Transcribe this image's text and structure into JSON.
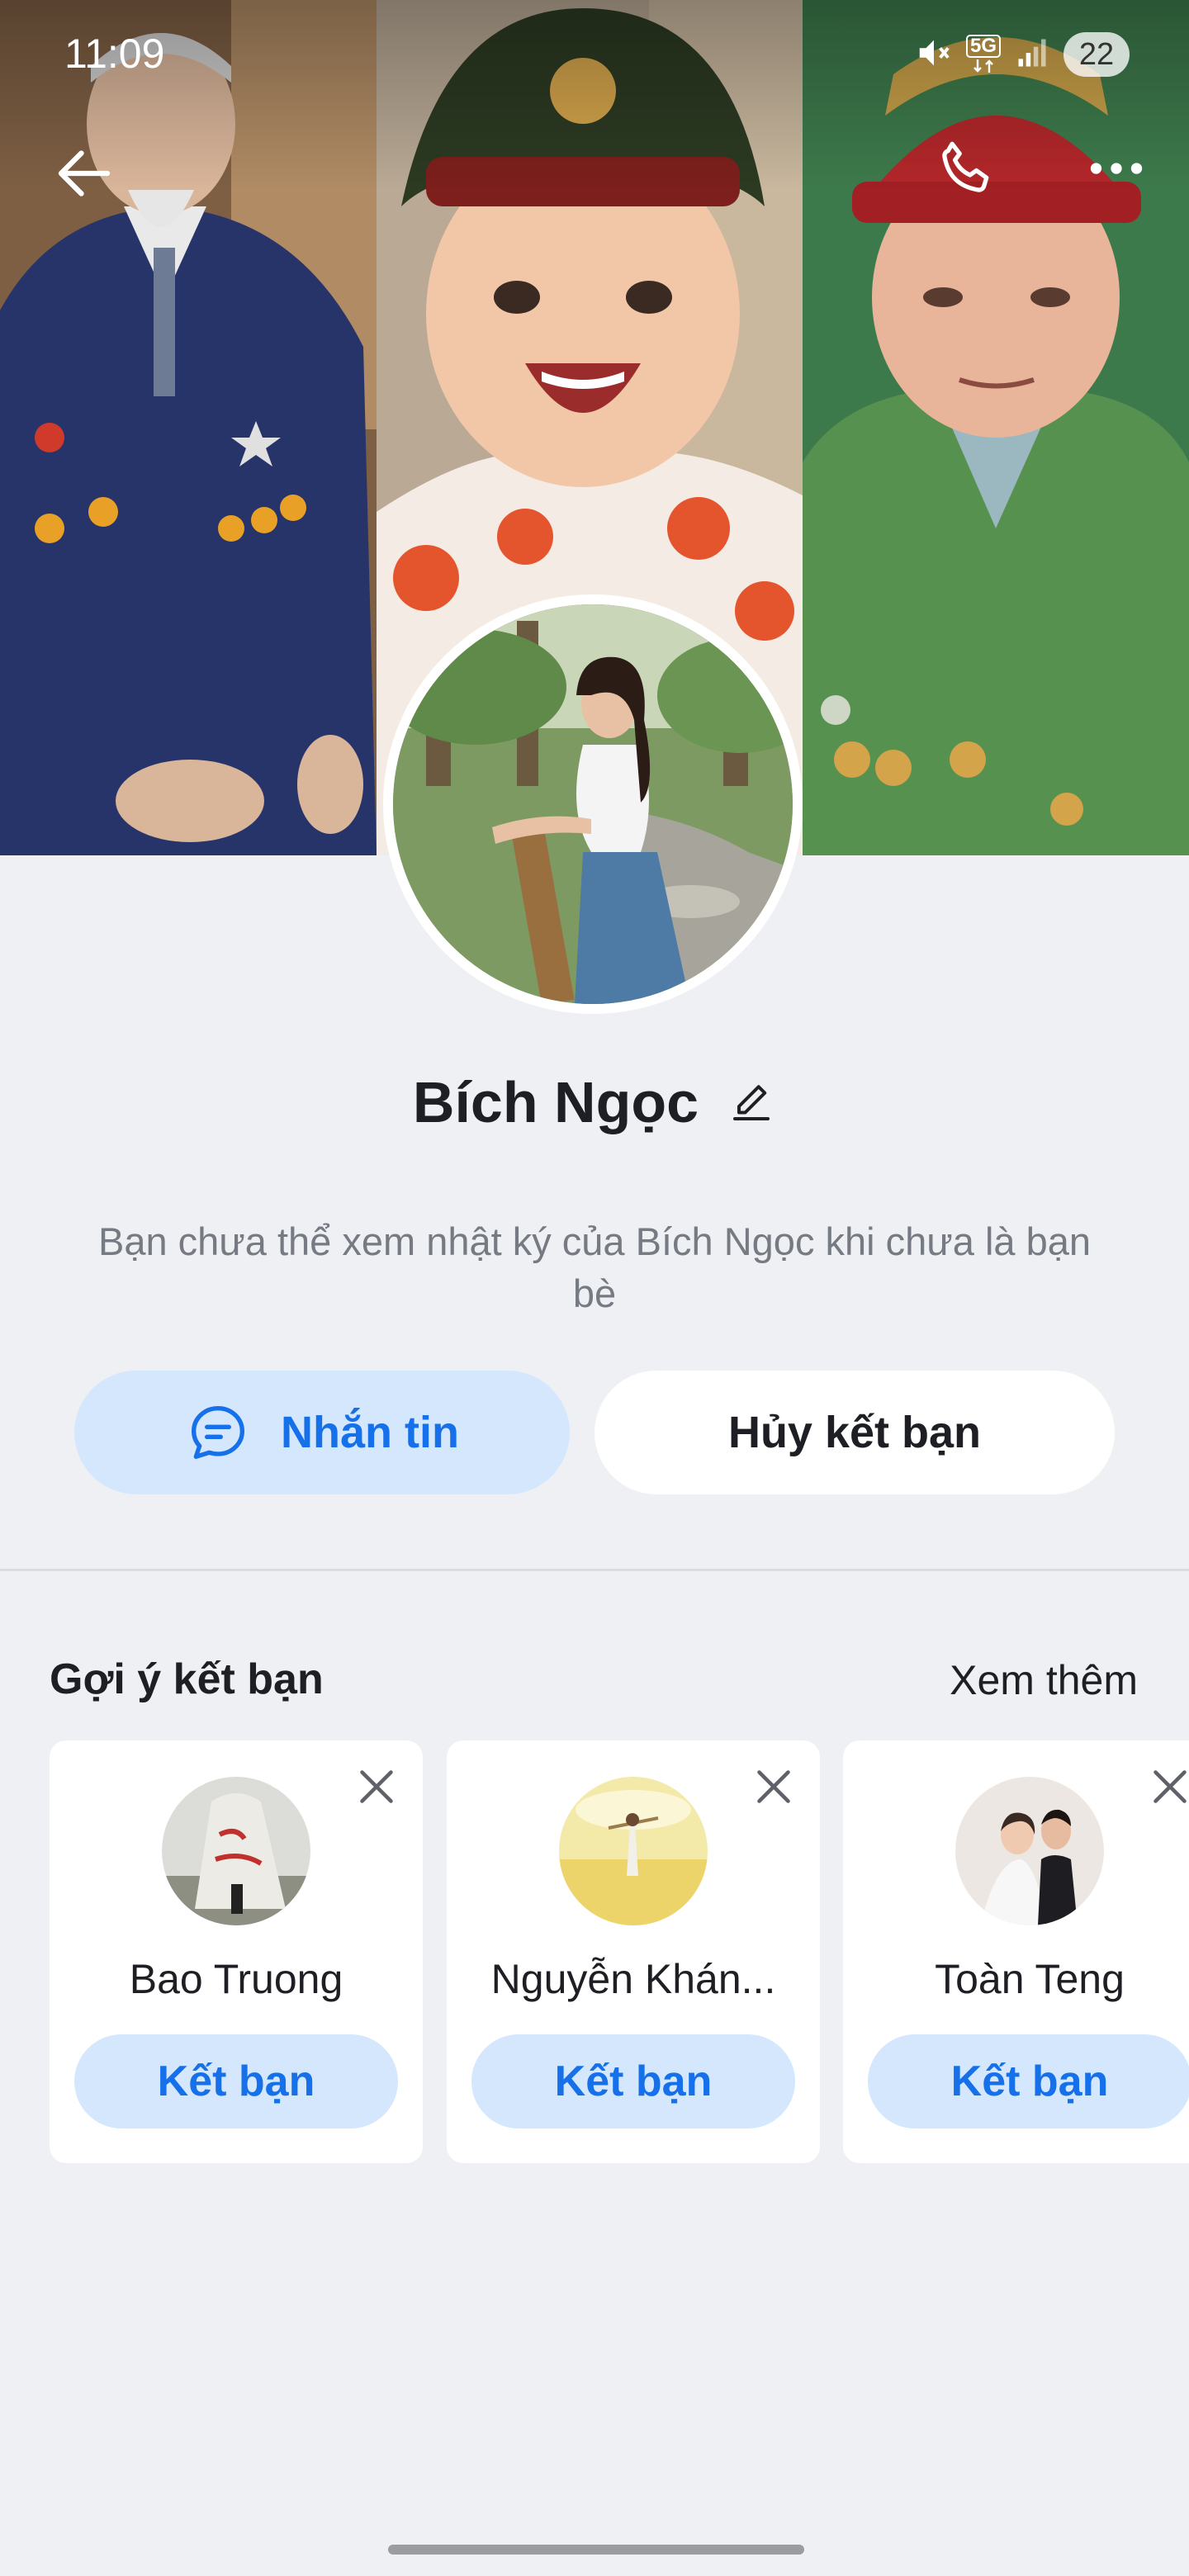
{
  "status_bar": {
    "time": "11:09",
    "network": "5G",
    "battery": "22",
    "icons": [
      "mute-icon",
      "5g-icon",
      "signal-icon",
      "battery-icon"
    ]
  },
  "nav": {
    "back_icon": "arrow-left-icon",
    "call_icon": "phone-icon",
    "more_icon": "more-horizontal-icon"
  },
  "profile": {
    "name": "Bích Ngọc",
    "edit_icon": "pencil-icon",
    "notice": "Bạn chưa thể xem nhật ký của Bích Ngọc khi chưa là bạn bè"
  },
  "actions": {
    "message_label": "Nhắn tin",
    "message_icon": "chat-bubble-icon",
    "unfriend_label": "Hủy kết bạn"
  },
  "suggestions": {
    "title": "Gợi ý kết bạn",
    "see_more": "Xem thêm",
    "items": [
      {
        "name": "Bao Truong",
        "button": "Kết bạn"
      },
      {
        "name": "Nguyễn Khán...",
        "button": "Kết bạn"
      },
      {
        "name": "Toàn Teng",
        "button": "Kết bạn"
      }
    ]
  },
  "colors": {
    "accent": "#1670e9",
    "accent_soft": "#d5e7fd",
    "background": "#eff0f4",
    "muted_text": "#767a82"
  }
}
